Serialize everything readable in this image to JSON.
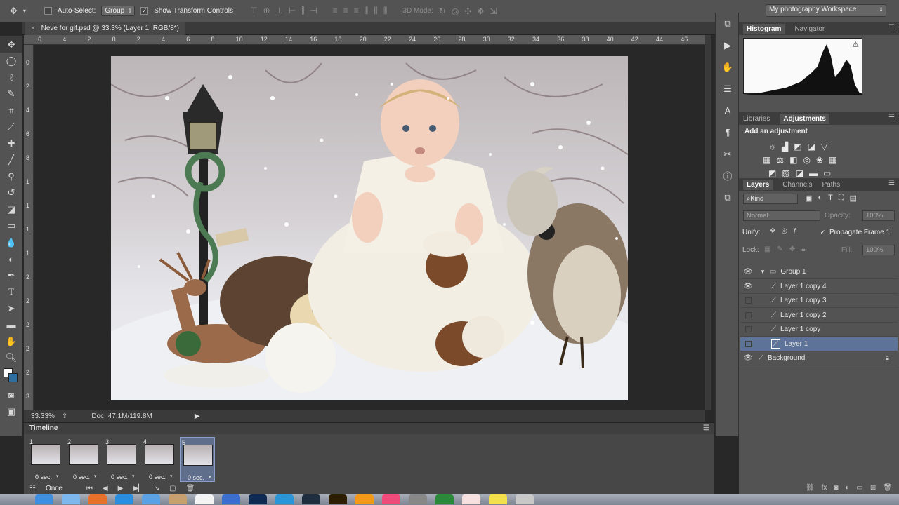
{
  "options_bar": {
    "auto_select_label": "Auto-Select:",
    "auto_select_value": "Group",
    "show_transform_label": "Show Transform Controls",
    "mode_3d_label": "3D Mode:"
  },
  "workspace": {
    "value": "My photography Workspace"
  },
  "document": {
    "tab_title": "Neve for gif.psd @ 33.3% (Layer 1, RGB/8*)",
    "zoom": "33.33%",
    "doc_size": "Doc: 47.1M/119.8M"
  },
  "ruler": {
    "h_ticks": [
      "6",
      "4",
      "2",
      "0",
      "2",
      "4",
      "6",
      "8",
      "10",
      "12",
      "14",
      "16",
      "18",
      "20",
      "22",
      "24",
      "26",
      "28",
      "30",
      "32",
      "34",
      "36",
      "38",
      "40",
      "42",
      "44",
      "46"
    ],
    "v_ticks": [
      "0",
      "2",
      "4",
      "6",
      "8",
      "1",
      "1",
      "1",
      "1",
      "2",
      "2",
      "2",
      "2",
      "2",
      "3",
      "3"
    ]
  },
  "timeline": {
    "title": "Timeline",
    "frames": [
      {
        "num": "1",
        "duration": "0 sec."
      },
      {
        "num": "2",
        "duration": "0 sec."
      },
      {
        "num": "3",
        "duration": "0 sec."
      },
      {
        "num": "4",
        "duration": "0 sec."
      },
      {
        "num": "5",
        "duration": "0 sec."
      }
    ],
    "loop": "Once"
  },
  "histogram_panel": {
    "tabs": [
      "Histogram",
      "Navigator"
    ]
  },
  "adjustments_panel": {
    "tabs": [
      "Libraries",
      "Adjustments"
    ],
    "heading": "Add an adjustment"
  },
  "layers_panel": {
    "tabs": [
      "Layers",
      "Channels",
      "Paths"
    ],
    "filter_kind": "Kind",
    "blend_mode": "Normal",
    "opacity_label": "Opacity:",
    "opacity_value": "100%",
    "unify_label": "Unify:",
    "propagate_label": "Propagate Frame 1",
    "lock_label": "Lock:",
    "fill_label": "Fill:",
    "fill_value": "100%",
    "layers": [
      {
        "name": "Group 1",
        "visible": true,
        "group": true
      },
      {
        "name": "Layer 1 copy 4",
        "visible": true
      },
      {
        "name": "Layer 1 copy 3",
        "visible": false
      },
      {
        "name": "Layer 1 copy 2",
        "visible": false
      },
      {
        "name": "Layer 1 copy",
        "visible": false
      },
      {
        "name": "Layer 1",
        "visible": false,
        "selected": true
      },
      {
        "name": "Background",
        "visible": true,
        "locked": true
      }
    ]
  },
  "colors": {
    "panel_bg": "#535353",
    "selection": "#5d7397",
    "canvas_bg": "#282828"
  }
}
